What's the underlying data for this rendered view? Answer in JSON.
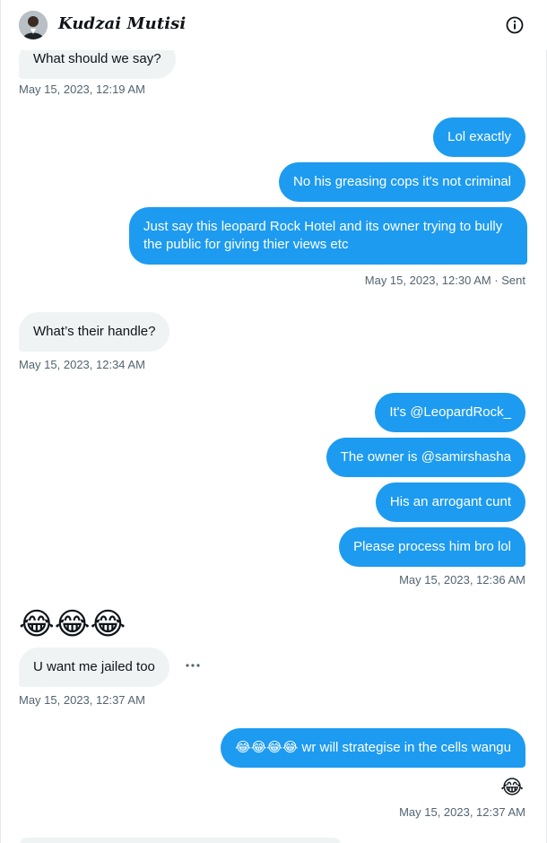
{
  "header": {
    "name": "Kudzai Mutisi",
    "info_icon": "info-circle-icon",
    "avatar_icon": "user-avatar"
  },
  "messages": [
    {
      "from": "them",
      "text": "What should we say?"
    },
    {
      "from": "them_time",
      "text": "May 15, 2023, 12:19 AM"
    },
    {
      "from": "me",
      "text": "Lol exactly"
    },
    {
      "from": "me",
      "text": "No his greasing cops it's not criminal"
    },
    {
      "from": "me",
      "text": "Just say this leopard Rock Hotel and its owner trying to bully the public for giving thier views etc"
    },
    {
      "from": "me_time",
      "text": "May 15, 2023, 12:30 AM · Sent"
    },
    {
      "from": "them",
      "text": "What’s their handle?"
    },
    {
      "from": "them_time",
      "text": "May 15, 2023, 12:34 AM"
    },
    {
      "from": "me",
      "text": "It's @LeopardRock_"
    },
    {
      "from": "me",
      "text": "The owner is @samirshasha"
    },
    {
      "from": "me",
      "text": "His an arrogant cunt"
    },
    {
      "from": "me",
      "text": "Please process him bro lol"
    },
    {
      "from": "me_time",
      "text": "May 15, 2023, 12:36 AM"
    },
    {
      "from": "them_emoji",
      "text": "😂😂😂"
    },
    {
      "from": "them",
      "text": "U want me jailed too"
    },
    {
      "from": "them_time",
      "text": "May 15, 2023, 12:37 AM"
    },
    {
      "from": "me",
      "text": "😂😂😂😂 wr will strategise in the cells wangu"
    },
    {
      "from": "me_reaction",
      "text": "😂"
    },
    {
      "from": "me_time",
      "text": "May 15, 2023, 12:37 AM"
    }
  ],
  "more_icon": "more-horizontal-icon",
  "colors": {
    "accent": "#1d9bf0",
    "incoming_bg": "#eff3f4",
    "secondary_text": "#536471"
  }
}
